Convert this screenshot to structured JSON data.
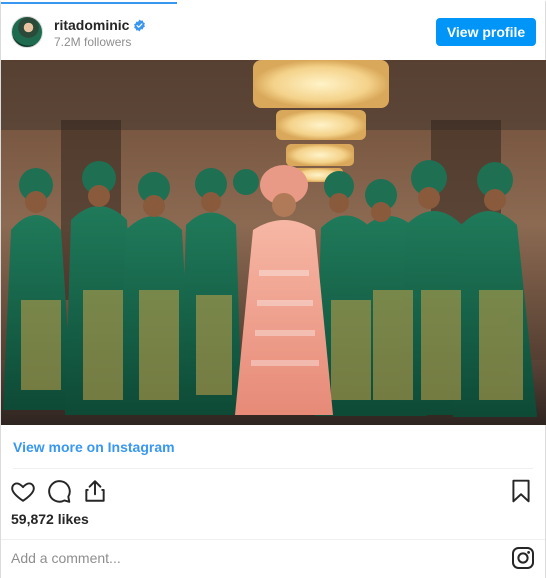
{
  "header": {
    "username": "ritadominic",
    "followers": "7.2M followers",
    "view_profile_label": "View profile",
    "avatar_icon": "profile-avatar",
    "verified_icon": "verified-badge-icon"
  },
  "post": {
    "image_icon": "post-photo",
    "view_more_label": "View more on Instagram",
    "likes": "59,872 likes",
    "actions": [
      "heart-icon",
      "comment-icon",
      "share-icon"
    ],
    "bookmark_icon": "bookmark-icon"
  },
  "comment": {
    "placeholder": "Add a comment...",
    "instagram_icon": "instagram-icon"
  },
  "colors": {
    "accent": "#0095f6",
    "link": "#3897f0",
    "text": "#262626",
    "muted": "#8e8e8e",
    "border": "#dbdbdb"
  }
}
